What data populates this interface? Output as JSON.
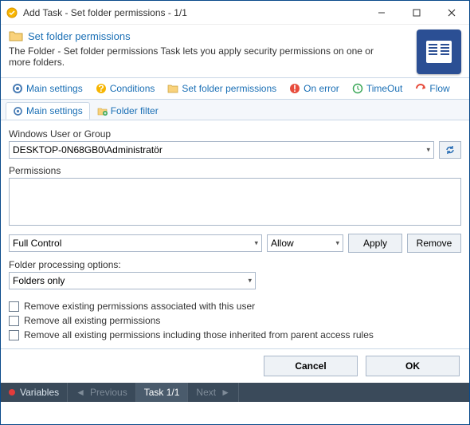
{
  "window": {
    "title": "Add Task - Set folder permissions - 1/1"
  },
  "header": {
    "title": "Set folder permissions",
    "description": "The Folder - Set folder permissions Task lets you apply security permissions on one or more folders."
  },
  "tabs": {
    "main": "Main settings",
    "conditions": "Conditions",
    "set_perm": "Set folder permissions",
    "on_error": "On error",
    "timeout": "TimeOut",
    "flow": "Flow"
  },
  "subtabs": {
    "main": "Main settings",
    "filter": "Folder filter"
  },
  "form": {
    "user_label": "Windows User or Group",
    "user_value": "DESKTOP-0N68GB0\\Administratör",
    "perm_label": "Permissions",
    "access_select": "Full Control",
    "type_select": "Allow",
    "apply_btn": "Apply",
    "remove_btn": "Remove",
    "proc_label": "Folder processing options:",
    "proc_value": "Folders only",
    "chk1": "Remove existing permissions associated with this user",
    "chk2": "Remove all existing permissions",
    "chk3": "Remove all existing permissions including those inherited from parent access rules"
  },
  "footer": {
    "cancel": "Cancel",
    "ok": "OK"
  },
  "status": {
    "variables": "Variables",
    "previous": "Previous",
    "task": "Task 1/1",
    "next": "Next"
  }
}
